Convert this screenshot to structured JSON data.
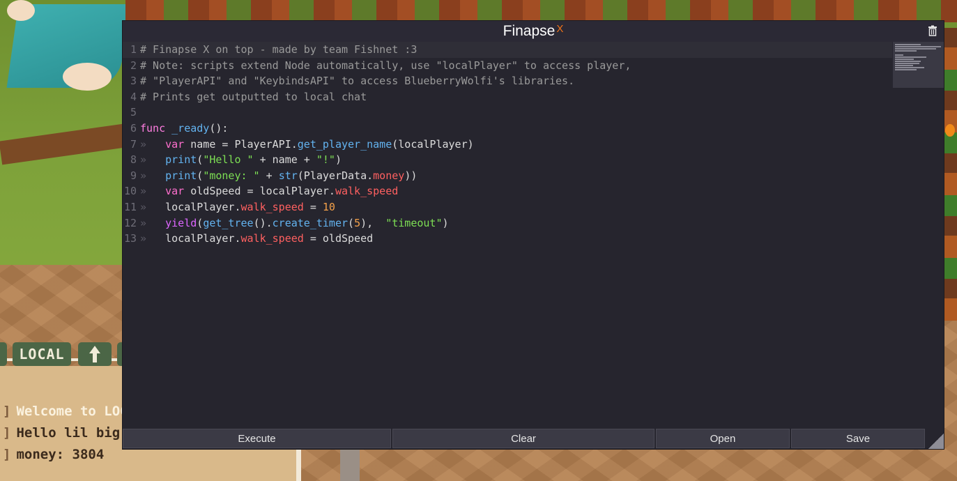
{
  "window": {
    "title": "Finapse",
    "title_accent": "X",
    "delete_icon": "trash-icon"
  },
  "editor": {
    "lines": [
      [
        {
          "t": "# Finapse X on top - made by team Fishnet :3",
          "c": "comment"
        }
      ],
      [
        {
          "t": "# Note: scripts extend Node automatically, use \"localPlayer\" to access player,",
          "c": "comment"
        }
      ],
      [
        {
          "t": "# \"PlayerAPI\" and \"KeybindsAPI\" to access BlueberryWolfi's libraries.",
          "c": "comment"
        }
      ],
      [
        {
          "t": "# Prints get outputted to local chat",
          "c": "comment"
        }
      ],
      [],
      [
        {
          "t": "func",
          "c": "kw"
        },
        {
          "t": " _ready",
          "c": "fn"
        },
        {
          "t": "():",
          "c": "plain"
        }
      ],
      [
        {
          "t": "tab"
        },
        {
          "t": "var",
          "c": "kw2"
        },
        {
          "t": " name = PlayerAPI.",
          "c": "plain"
        },
        {
          "t": "get_player_name",
          "c": "fn"
        },
        {
          "t": "(localPlayer)",
          "c": "plain"
        }
      ],
      [
        {
          "t": "tab"
        },
        {
          "t": "print",
          "c": "fn"
        },
        {
          "t": "(",
          "c": "plain"
        },
        {
          "t": "\"Hello \"",
          "c": "str"
        },
        {
          "t": " + name + ",
          "c": "plain"
        },
        {
          "t": "\"!\"",
          "c": "str"
        },
        {
          "t": ")",
          "c": "plain"
        }
      ],
      [
        {
          "t": "tab"
        },
        {
          "t": "print",
          "c": "fn"
        },
        {
          "t": "(",
          "c": "plain"
        },
        {
          "t": "\"money: \"",
          "c": "str"
        },
        {
          "t": " + ",
          "c": "plain"
        },
        {
          "t": "str",
          "c": "fn"
        },
        {
          "t": "(PlayerData.",
          "c": "plain"
        },
        {
          "t": "money",
          "c": "prop"
        },
        {
          "t": "))",
          "c": "plain"
        }
      ],
      [
        {
          "t": "tab"
        },
        {
          "t": "var",
          "c": "kw2"
        },
        {
          "t": " oldSpeed = localPlayer.",
          "c": "plain"
        },
        {
          "t": "walk_speed",
          "c": "prop"
        }
      ],
      [
        {
          "t": "tab"
        },
        {
          "t": "localPlayer.",
          "c": "plain"
        },
        {
          "t": "walk_speed",
          "c": "prop"
        },
        {
          "t": " = ",
          "c": "plain"
        },
        {
          "t": "10",
          "c": "num"
        }
      ],
      [
        {
          "t": "tab"
        },
        {
          "t": "yield",
          "c": "ctl"
        },
        {
          "t": "(",
          "c": "plain"
        },
        {
          "t": "get_tree",
          "c": "fn"
        },
        {
          "t": "().",
          "c": "plain"
        },
        {
          "t": "create_timer",
          "c": "fn"
        },
        {
          "t": "(",
          "c": "plain"
        },
        {
          "t": "5",
          "c": "num"
        },
        {
          "t": "),  ",
          "c": "plain"
        },
        {
          "t": "\"timeout\"",
          "c": "str"
        },
        {
          "t": ")",
          "c": "plain"
        }
      ],
      [
        {
          "t": "tab"
        },
        {
          "t": "localPlayer.",
          "c": "plain"
        },
        {
          "t": "walk_speed",
          "c": "prop"
        },
        {
          "t": " = oldSpeed",
          "c": "plain"
        }
      ]
    ],
    "tab_glyph": "»"
  },
  "buttons": {
    "execute": "Execute",
    "clear": "Clear",
    "open": "Open",
    "save": "Save"
  },
  "chat": {
    "tab_local": "LOCAL",
    "tab_up_glyph": "🡅",
    "messages": [
      {
        "prefix": "]",
        "text": "Welcome to LOC"
      },
      {
        "prefix": "]",
        "text": "Hello lil big cho"
      },
      {
        "prefix": "]",
        "text": "money: 3804"
      }
    ]
  },
  "colors": {
    "accent": "#f07318",
    "editor_bg": "#26252e",
    "chat_tab_bg": "#4b6646"
  }
}
